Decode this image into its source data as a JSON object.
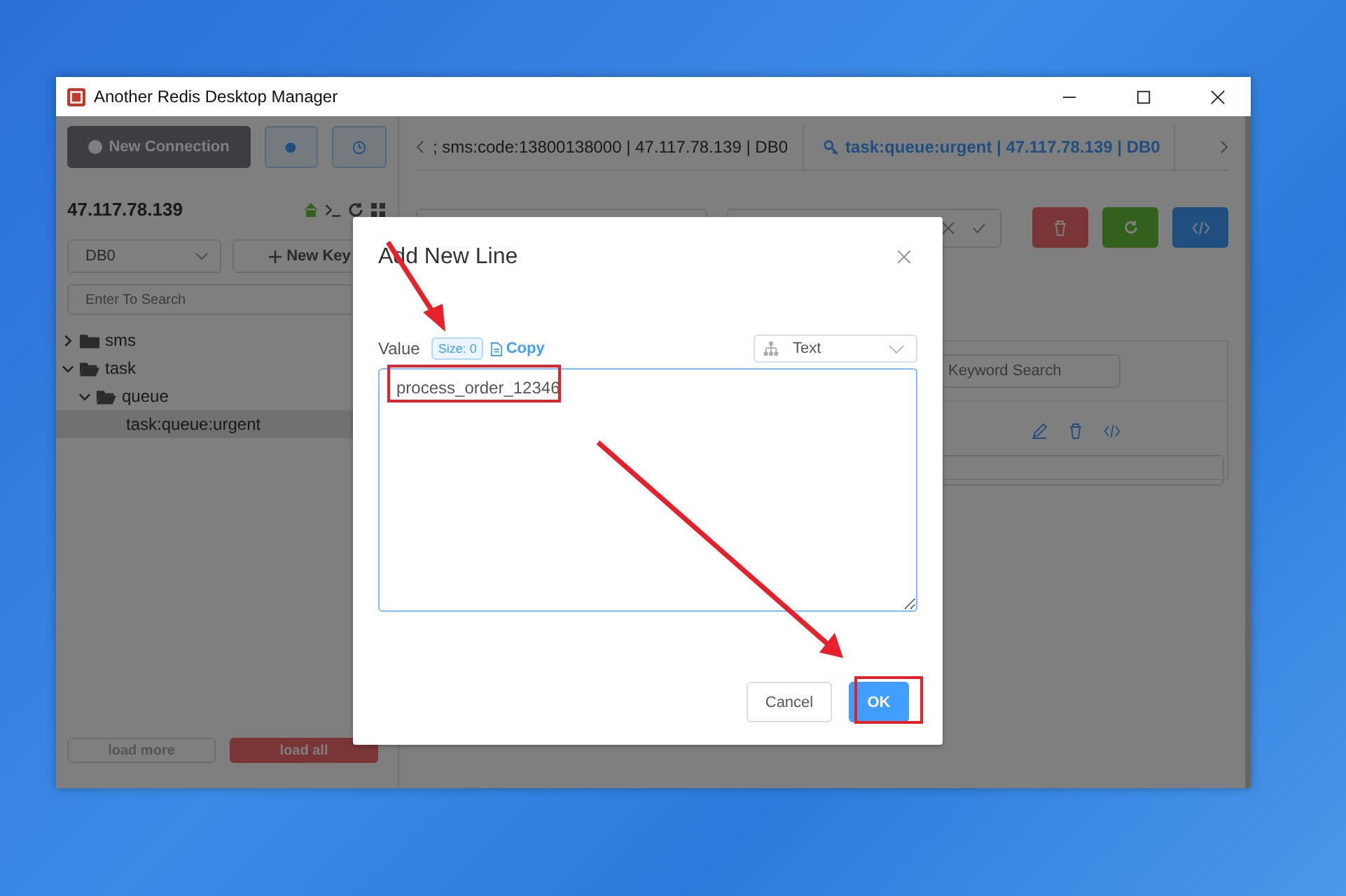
{
  "window": {
    "title": "Another Redis Desktop Manager"
  },
  "sidebar": {
    "new_connection_button": "New Connection",
    "connection_name": "47.117.78.139",
    "db_select": "DB0",
    "new_key_button": "New Key",
    "search": {
      "placeholder": "Enter To Search"
    },
    "tree": [
      {
        "label": "sms",
        "expanded": false,
        "selected": false,
        "kind": "folder"
      },
      {
        "label": "task",
        "expanded": true,
        "selected": false,
        "kind": "folder",
        "children": [
          {
            "label": "queue",
            "expanded": true,
            "selected": false,
            "kind": "folder",
            "children": [
              {
                "label": "task:queue:urgent",
                "selected": true,
                "kind": "key"
              }
            ]
          }
        ]
      }
    ],
    "load_more_button": "load more",
    "load_all_button": "load all"
  },
  "tabs": [
    {
      "label": "; sms:code:13800138000 | 47.117.78.139 | DB0",
      "selected": false
    },
    {
      "label": "task:queue:urgent | 47.117.78.139 | DB0",
      "selected": true
    }
  ],
  "list_panel": {
    "search": {
      "placeholder": "Keyword Search"
    }
  },
  "dialog": {
    "title": "Add New Line",
    "value_label": "Value",
    "size_badge": "Size: 0",
    "copy_link": "Copy",
    "format_select": "Text",
    "value": "process_order_12346",
    "buttons": [
      {
        "label": "Cancel",
        "kind": "default"
      },
      {
        "label": "OK",
        "kind": "primary"
      }
    ]
  }
}
